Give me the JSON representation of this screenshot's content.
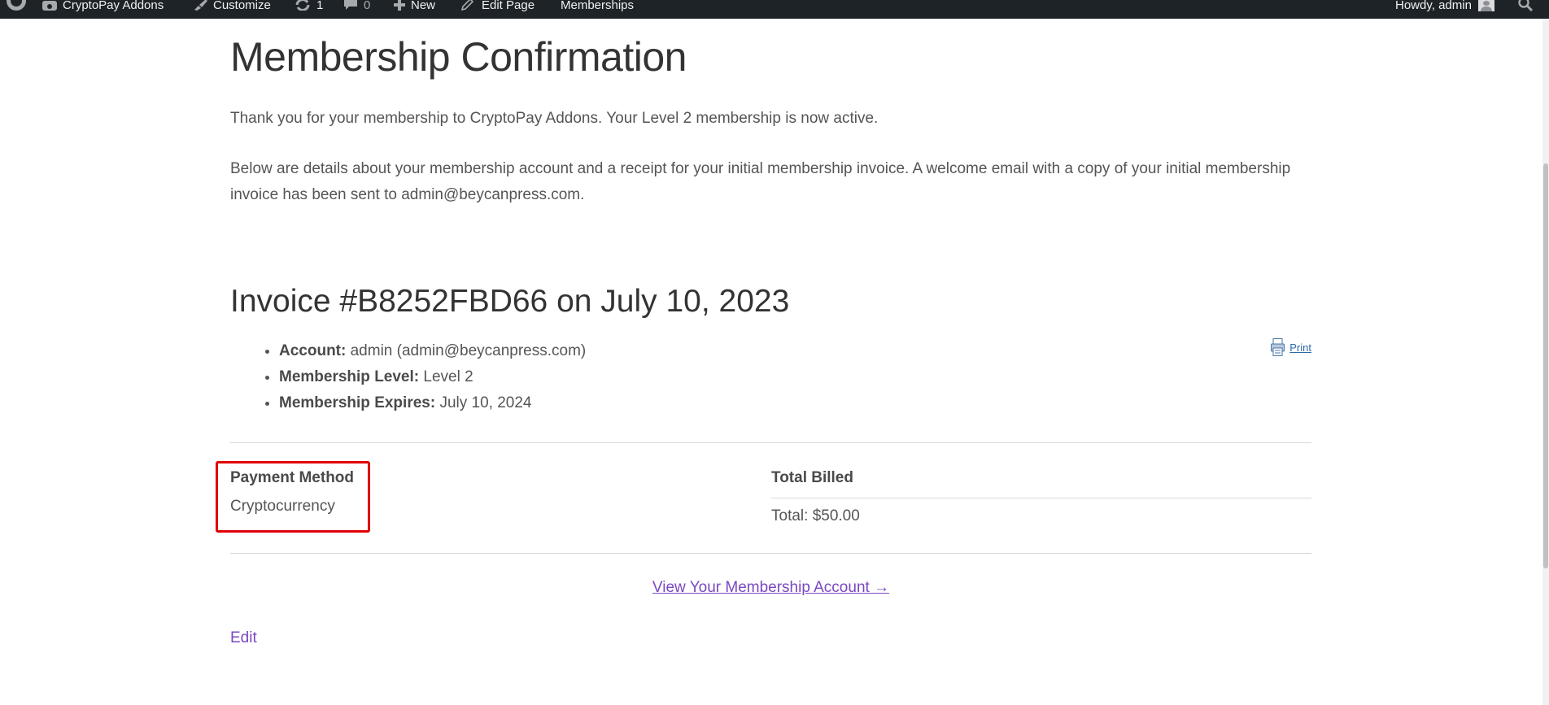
{
  "adminbar": {
    "site_name": "CryptoPay Addons",
    "customize": "Customize",
    "updates_count": "1",
    "comments_count": "0",
    "new_label": "New",
    "edit_page": "Edit Page",
    "memberships": "Memberships",
    "howdy": "Howdy, admin"
  },
  "page": {
    "title": "Membership Confirmation",
    "thanks": "Thank you for your membership to CryptoPay Addons. Your Level 2 membership is now active.",
    "details": "Below are details about your membership account and a receipt for your initial membership invoice. A welcome email with a copy of your initial membership invoice has been sent to admin@beycanpress.com."
  },
  "invoice": {
    "title": "Invoice #B8252FBD66 on July 10, 2023",
    "print_label": "Print",
    "items": [
      {
        "label": "Account:",
        "value": " admin (admin@beycanpress.com)"
      },
      {
        "label": "Membership Level:",
        "value": " Level 2"
      },
      {
        "label": "Membership Expires:",
        "value": " July 10, 2024"
      }
    ],
    "payment_method_heading": "Payment Method",
    "payment_method_value": "Cryptocurrency",
    "total_billed_heading": "Total Billed",
    "total_value": "Total: $50.00"
  },
  "links": {
    "view_account": "View Your Membership Account →",
    "edit": "Edit"
  },
  "colors": {
    "adminbar_bg": "#1d2327",
    "link_purple": "#7a48c0",
    "highlight_red": "#e00000"
  }
}
